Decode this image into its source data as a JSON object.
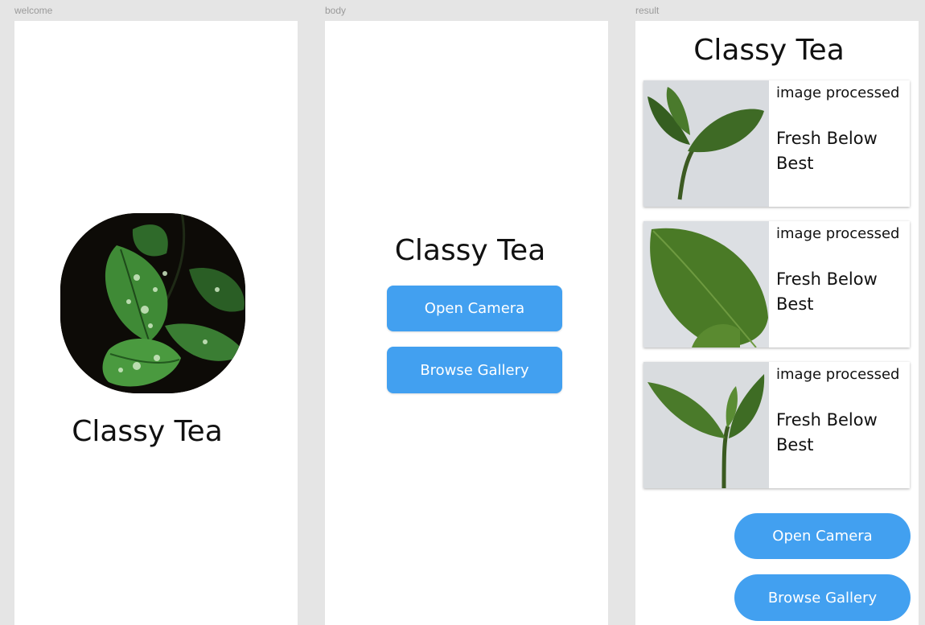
{
  "frames": {
    "welcome": {
      "label": "welcome"
    },
    "body": {
      "label": "body"
    },
    "result": {
      "label": "result"
    }
  },
  "app": {
    "title": "Classy Tea"
  },
  "actions": {
    "open_camera": "Open Camera",
    "browse_gallery": "Browse Gallery"
  },
  "results": [
    {
      "status": "image processed",
      "label": "Fresh Below Best"
    },
    {
      "status": "image processed",
      "label": "Fresh Below Best"
    },
    {
      "status": "image processed",
      "label": "Fresh Below Best"
    }
  ],
  "colors": {
    "accent": "#42a0f0",
    "canvas": "#e5e5e5"
  },
  "icons": {
    "logo": "tea-leaf-logo",
    "leaf_photo": "tea-leaf-photo"
  }
}
